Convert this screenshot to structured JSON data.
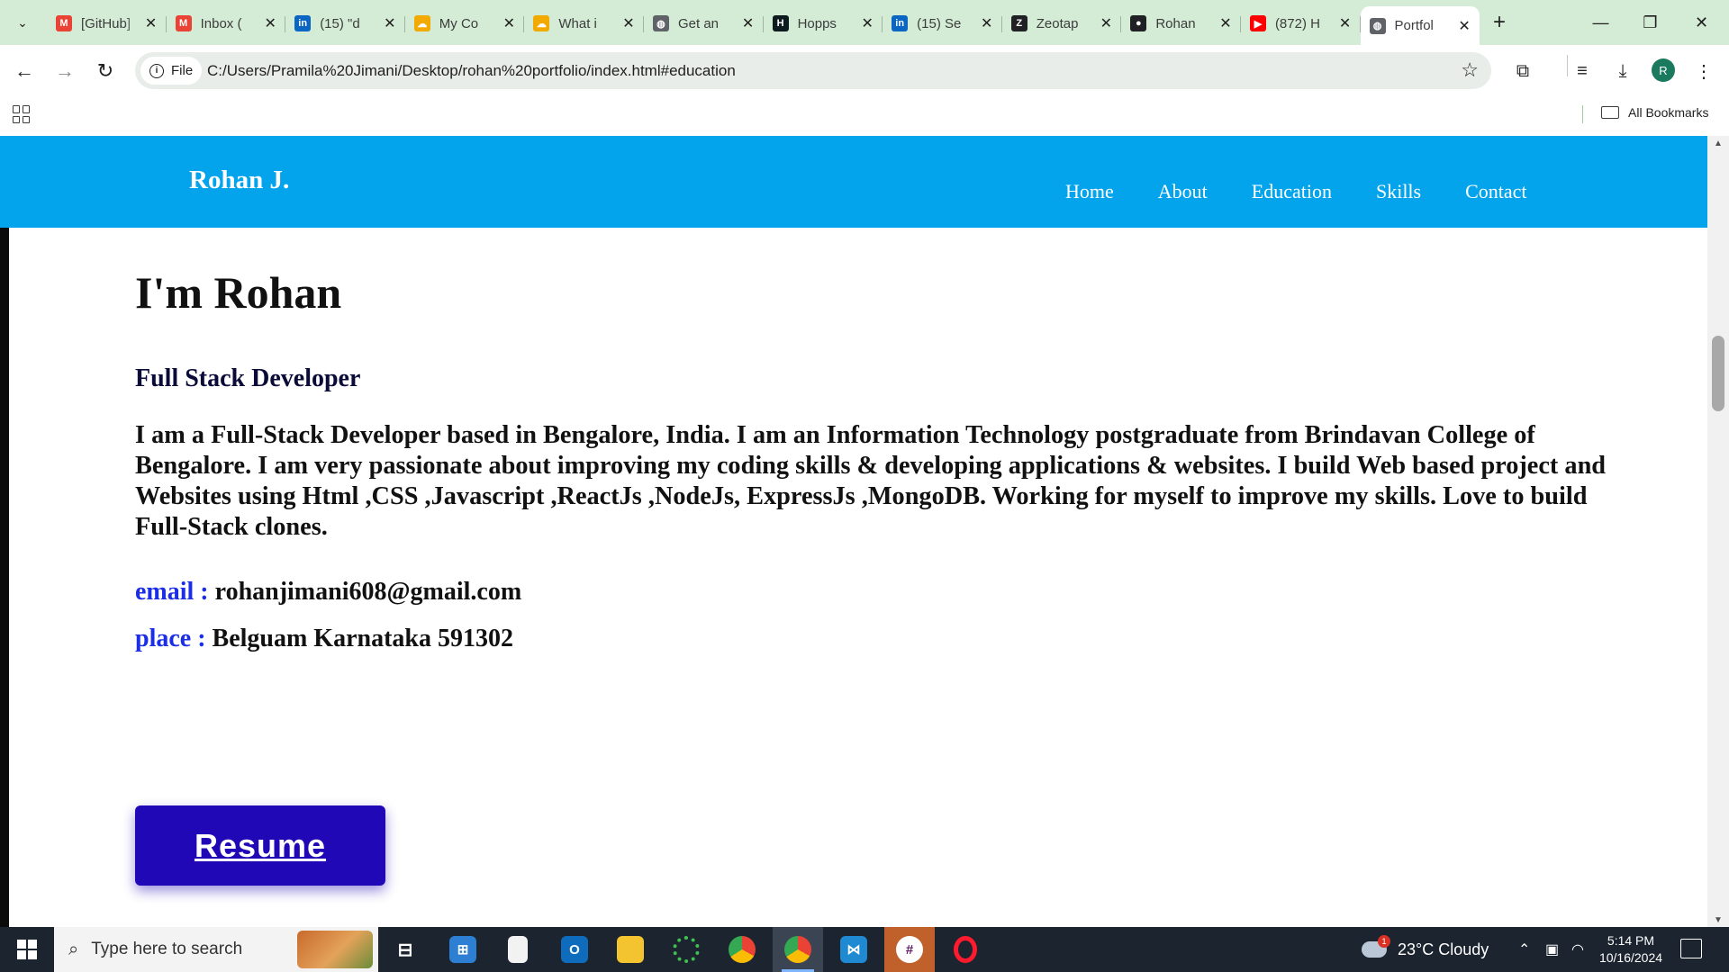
{
  "browser": {
    "tabs": [
      {
        "title": "[GitHub]",
        "icon": "gmail-icon",
        "color": "#ea4335",
        "glyph": "M"
      },
      {
        "title": "Inbox (",
        "icon": "gmail-icon",
        "color": "#ea4335",
        "glyph": "M"
      },
      {
        "title": "(15) \"d",
        "icon": "linkedin-icon",
        "color": "#0a66c2",
        "glyph": "in"
      },
      {
        "title": "My Co",
        "icon": "cloud-icon",
        "color": "#f2a900",
        "glyph": "☁"
      },
      {
        "title": "What i",
        "icon": "cloud-icon",
        "color": "#f2a900",
        "glyph": "☁"
      },
      {
        "title": "Get an",
        "icon": "globe-icon",
        "color": "#5f6368",
        "glyph": "◍"
      },
      {
        "title": "Hopps",
        "icon": "hoppscotch-icon",
        "color": "#0d1b1e",
        "glyph": "H"
      },
      {
        "title": "(15) Se",
        "icon": "linkedin-icon",
        "color": "#0a66c2",
        "glyph": "in"
      },
      {
        "title": "Zeotap",
        "icon": "zeotap-icon",
        "color": "#202124",
        "glyph": "Z"
      },
      {
        "title": "Rohan",
        "icon": "github-icon",
        "color": "#202124",
        "glyph": "●"
      },
      {
        "title": "(872) H",
        "icon": "youtube-icon",
        "color": "#ff0000",
        "glyph": "▶"
      },
      {
        "title": "Portfol",
        "icon": "globe-icon",
        "color": "#5f6368",
        "glyph": "◍"
      }
    ],
    "active_tab_index": 11,
    "address": {
      "chip_label": "File",
      "url": "C:/Users/Pramila%20Jimani/Desktop/rohan%20portfolio/index.html#education"
    },
    "profile_initial": "R",
    "bookmarks_label": "All Bookmarks"
  },
  "site": {
    "logo": "Rohan J.",
    "nav": [
      "Home",
      "About",
      "Education",
      "Skills",
      "Contact"
    ],
    "heading": "I'm Rohan",
    "role": "Full Stack Developer",
    "bio": "I am a Full-Stack Developer based in Bengalore, India. I am an Information Technology postgraduate from Brindavan College of Bengalore. I am very passionate about improving my coding skills & developing applications & websites. I build Web based project and Websites using Html ,CSS ,Javascript ,ReactJs ,NodeJs, ExpressJs ,MongoDB. Working for myself to improve my skills. Love to build Full-Stack clones.",
    "email_label": "email :",
    "email_value": "rohanjimani608@gmail.com",
    "place_label": "place :",
    "place_value": "Belguam Karnataka 591302",
    "resume_label": "Resume",
    "colors": {
      "header": "#04a4ec",
      "label": "#1a2ee8",
      "button": "#2108b6"
    }
  },
  "taskbar": {
    "search_placeholder": "Type here to search",
    "weather": "23°C  Cloudy",
    "weather_badge": "1",
    "time": "5:14 PM",
    "date": "10/16/2024"
  }
}
